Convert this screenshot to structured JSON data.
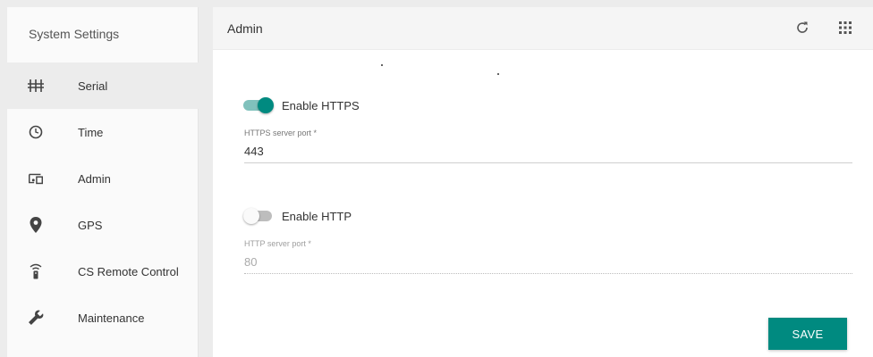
{
  "sidebar": {
    "title": "System Settings",
    "items": [
      {
        "label": "Serial",
        "icon": "serial-icon",
        "active": true
      },
      {
        "label": "Time",
        "icon": "clock-icon",
        "active": false
      },
      {
        "label": "Admin",
        "icon": "admin-devices-icon",
        "active": false
      },
      {
        "label": "GPS",
        "icon": "location-pin-icon",
        "active": false
      },
      {
        "label": "CS Remote Control",
        "icon": "remote-control-icon",
        "active": false
      },
      {
        "label": "Maintenance",
        "icon": "wrench-icon",
        "active": false
      }
    ]
  },
  "main": {
    "title": "Admin",
    "actions": [
      {
        "icon": "refresh-icon"
      },
      {
        "icon": "apps-grid-icon"
      }
    ],
    "https": {
      "toggle_label": "Enable HTTPS",
      "enabled": true,
      "port_label": "HTTPS server port *",
      "port_value": "443"
    },
    "http": {
      "toggle_label": "Enable HTTP",
      "enabled": false,
      "port_label": "HTTP server port *",
      "port_value": "80"
    },
    "save_label": "SAVE"
  },
  "colors": {
    "accent": "#008a80",
    "accent_light": "#80c1bc",
    "sidebar_bg": "#fafafa",
    "header_bg": "#f5f5f5"
  }
}
